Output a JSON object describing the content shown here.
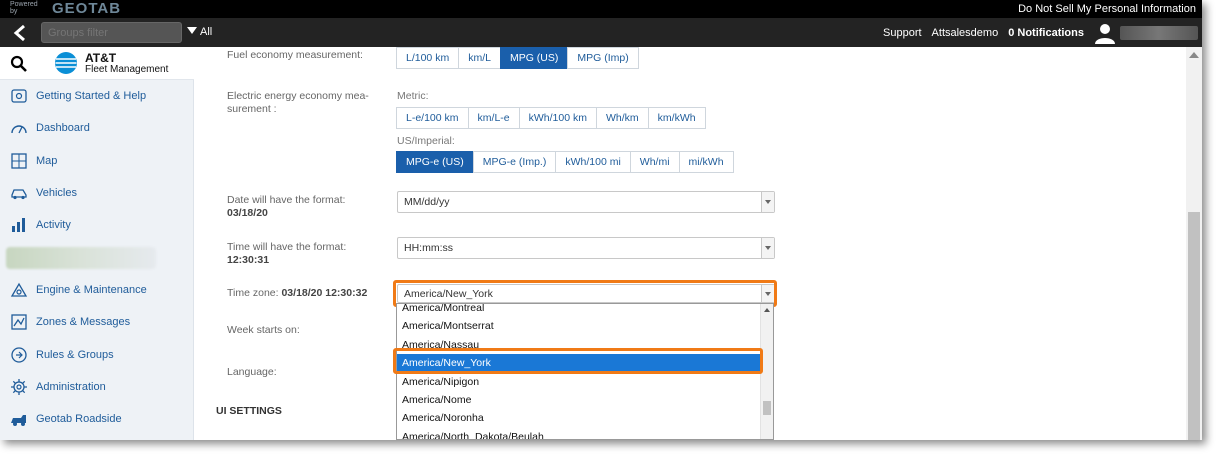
{
  "header": {
    "powered_by": "Powered by",
    "logo_text": "GEOTAB",
    "do_not_sell": "Do Not Sell My Personal Information"
  },
  "navbar": {
    "groups_filter_placeholder": "Groups filter",
    "all_label": "All",
    "support": "Support",
    "user": "Attsalesdemo",
    "notifications": "0 Notifications"
  },
  "sidebar": {
    "brand_name": "AT&T",
    "brand_sub": "Fleet Management",
    "items": [
      {
        "label": "Getting Started & Help",
        "icon": "help-icon"
      },
      {
        "label": "Dashboard",
        "icon": "dashboard-icon"
      },
      {
        "label": "Map",
        "icon": "map-icon"
      },
      {
        "label": "Vehicles",
        "icon": "vehicle-icon"
      },
      {
        "label": "Activity",
        "icon": "activity-icon"
      },
      {
        "label": "",
        "icon": "blurred-item"
      },
      {
        "label": "Engine & Maintenance",
        "icon": "engine-icon"
      },
      {
        "label": "Zones & Messages",
        "icon": "zones-icon"
      },
      {
        "label": "Rules & Groups",
        "icon": "rules-icon"
      },
      {
        "label": "Administration",
        "icon": "gear-icon"
      },
      {
        "label": "Geotab Roadside",
        "icon": "roadside-icon"
      }
    ]
  },
  "settings": {
    "fuel_label": "Fuel economy measurement:",
    "fuel_options": [
      "L/100 km",
      "km/L",
      "MPG (US)",
      "MPG (Imp)"
    ],
    "fuel_selected": "MPG (US)",
    "electric_label_1": "Electric energy economy mea-",
    "electric_label_2": "surement :",
    "metric_label": "Metric:",
    "metric_options": [
      "L-e/100 km",
      "km/L-e",
      "kWh/100 km",
      "Wh/km",
      "km/kWh"
    ],
    "us_label": "US/Imperial:",
    "us_options": [
      "MPG-e (US)",
      "MPG-e (Imp.)",
      "kWh/100 mi",
      "Wh/mi",
      "mi/kWh"
    ],
    "us_selected": "MPG-e (US)",
    "date_label": "Date will have the format:",
    "date_example": "03/18/20",
    "date_value": "MM/dd/yy",
    "time_label": "Time will have the format:",
    "time_example": "12:30:31",
    "time_value": "HH:mm:ss",
    "tz_label": "Time zone:",
    "tz_example": "03/18/20 12:30:32",
    "tz_value": "America/New_York",
    "week_label": "Week starts on:",
    "language_label": "Language:",
    "ui_settings": "UI SETTINGS"
  },
  "timezone_dropdown": {
    "items": [
      "America/Montreal",
      "America/Montserrat",
      "America/Nassau",
      "America/New_York",
      "America/Nipigon",
      "America/Nome",
      "America/Noronha",
      "America/North_Dakota/Beulah"
    ],
    "selected": "America/New_York"
  },
  "colors": {
    "accent": "#1a5fab",
    "highlight": "#f07a16",
    "selected_row": "#1a78d6"
  }
}
